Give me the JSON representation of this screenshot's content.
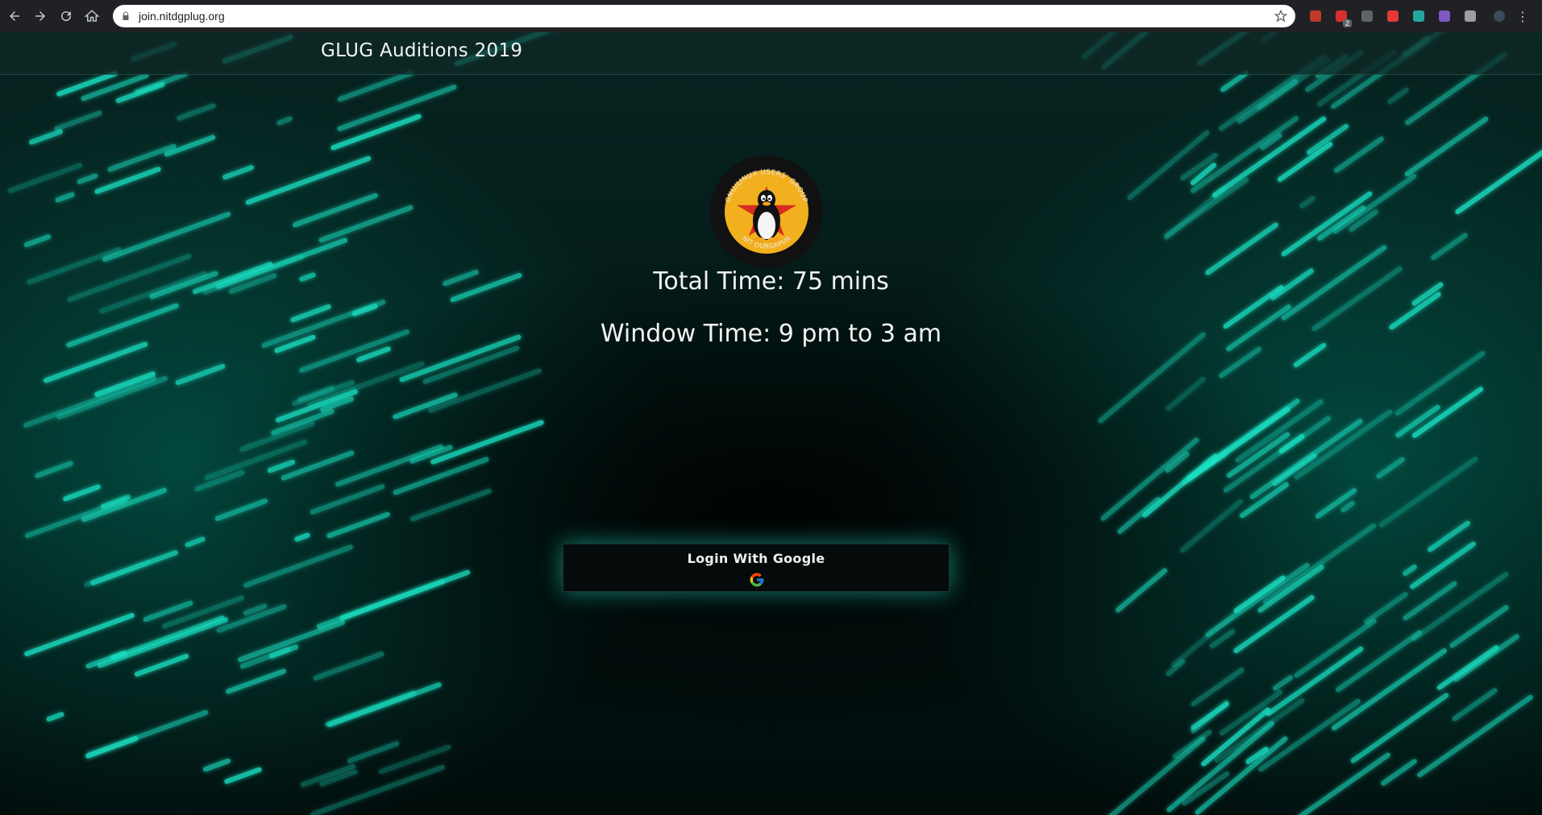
{
  "browser": {
    "url": "join.nitdgplug.org",
    "extensions": [
      {
        "name": "ublock-icon",
        "color": "#c0392b"
      },
      {
        "name": "lastpass-icon",
        "color": "#d32f2f",
        "badge": "2"
      },
      {
        "name": "pocket-icon",
        "color": "#5f6368"
      },
      {
        "name": "extension-red-icon",
        "color": "#e53935"
      },
      {
        "name": "extension-eyes-icon",
        "color": "#26a69a"
      },
      {
        "name": "extension-purple-icon",
        "color": "#7e57c2"
      },
      {
        "name": "extension-gray-icon",
        "color": "#9e9e9e"
      }
    ]
  },
  "header": {
    "title": "GLUG Auditions 2019"
  },
  "logo": {
    "top_text": "GNU/LINUX USERS' GROUP",
    "bottom_text": "NIT DURGAPUR"
  },
  "info": {
    "total_time": "Total Time: 75 mins",
    "window_time": "Window Time: 9 pm to 3 am"
  },
  "login": {
    "label": "Login With Google",
    "icon": "google-icon"
  },
  "colors": {
    "accent": "#19e0c2",
    "background": "#031a17",
    "button_bg": "#050b0b"
  }
}
